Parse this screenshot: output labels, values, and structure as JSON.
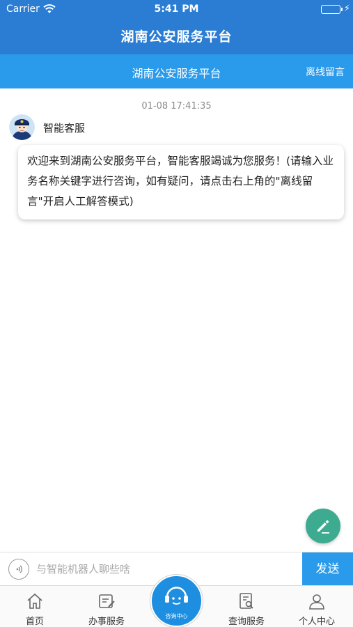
{
  "status_bar": {
    "carrier": "Carrier",
    "time": "5:41 PM",
    "battery_level": 1.0,
    "charging_glyph": "⚡"
  },
  "header": {
    "title": "湖南公安服务平台",
    "color": "#2b7cd3"
  },
  "subheader": {
    "title": "湖南公安服务平台",
    "offline_message_label": "离线留言",
    "color": "#2a9aeb"
  },
  "chat": {
    "timestamp": "01-08 17:41:35",
    "sender": {
      "name": "智能客服",
      "avatar_icon": "police-officer-avatar-icon"
    },
    "message": "欢迎来到湖南公安服务平台，智能客服竭诚为您服务！(请输入业务名称关键字进行咨询，如有疑问，请点击右上角的\"离线留言\"开启人工解答模式)"
  },
  "fab": {
    "icon": "pencil-icon",
    "color": "#3dab90"
  },
  "input_bar": {
    "voice_icon": "voice-icon",
    "placeholder": "与智能机器人聊些啥",
    "value": "",
    "send_label": "发送"
  },
  "tabbar": {
    "tabs": [
      {
        "label": "首页",
        "icon": "home-icon"
      },
      {
        "label": "办事服务",
        "icon": "edit-document-icon"
      },
      {
        "label": "查询服务",
        "icon": "search-document-icon"
      },
      {
        "label": "个人中心",
        "icon": "user-icon"
      }
    ],
    "center": {
      "label": "咨询中心",
      "icon": "customer-service-headset-icon"
    }
  }
}
